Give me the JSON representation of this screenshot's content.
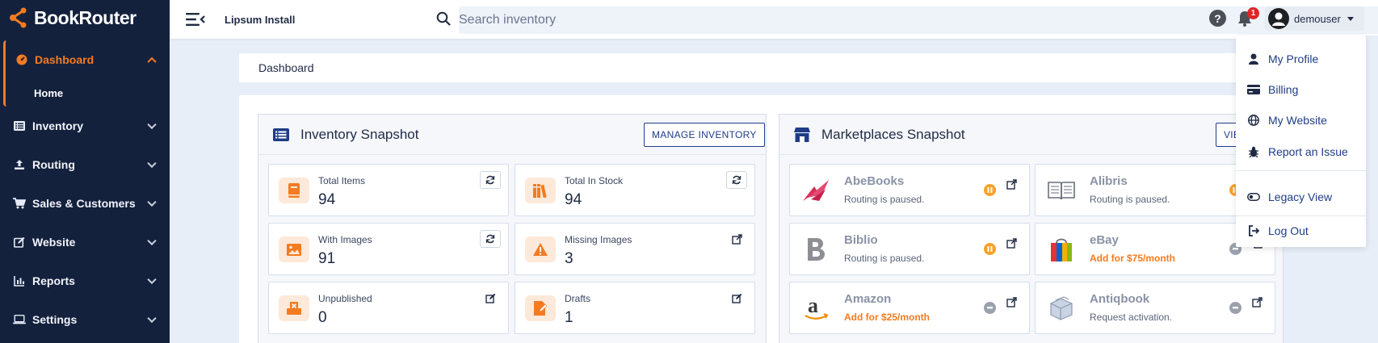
{
  "app": {
    "logo_text": "BookRouter"
  },
  "sidebar": {
    "items": [
      {
        "label": "Dashboard",
        "active": true
      },
      {
        "label": "Inventory"
      },
      {
        "label": "Routing"
      },
      {
        "label": "Sales & Customers"
      },
      {
        "label": "Website"
      },
      {
        "label": "Reports"
      },
      {
        "label": "Settings"
      }
    ],
    "sub_item": "Home"
  },
  "topbar": {
    "install_name": "Lipsum Install",
    "search_placeholder": "Search inventory",
    "help_symbol": "?",
    "notification_count": "1",
    "user_name": "demouser"
  },
  "breadcrumb": "Dashboard",
  "inventory": {
    "title": "Inventory Snapshot",
    "button": "MANAGE INVENTORY",
    "tiles": [
      {
        "label": "Total Items",
        "value": "94",
        "icon": "book-icon",
        "action": "refresh-icon"
      },
      {
        "label": "Total In Stock",
        "value": "94",
        "icon": "books-shelf-icon",
        "action": "refresh-icon"
      },
      {
        "label": "With Images",
        "value": "91",
        "icon": "image-icon",
        "action": "refresh-icon"
      },
      {
        "label": "Missing Images",
        "value": "3",
        "icon": "warning-icon",
        "action": "external-link-icon"
      },
      {
        "label": "Unpublished",
        "value": "0",
        "icon": "unpublished-icon",
        "action": "edit-icon"
      },
      {
        "label": "Drafts",
        "value": "1",
        "icon": "draft-icon",
        "action": "edit-icon"
      }
    ]
  },
  "marketplaces": {
    "title": "Marketplaces Snapshot",
    "button": "VIE",
    "tiles": [
      {
        "name": "AbeBooks",
        "status": "Routing is paused.",
        "state": "paused"
      },
      {
        "name": "Alibris",
        "status": "Routing is paused.",
        "state": "paused"
      },
      {
        "name": "Biblio",
        "status": "Routing is paused.",
        "state": "paused"
      },
      {
        "name": "eBay",
        "status": "Add for $75/month",
        "state": "off"
      },
      {
        "name": "Amazon",
        "status": "Add for $25/month",
        "state": "off"
      },
      {
        "name": "Antiqbook",
        "status": "Request activation.",
        "state": "off"
      }
    ]
  },
  "user_menu": {
    "items": [
      "My Profile",
      "Billing",
      "My Website",
      "Report an Issue",
      "Legacy View",
      "Log Out"
    ]
  },
  "colors": {
    "sidebar": "#14213d",
    "accent": "#f47b20",
    "link": "#1f3c88"
  }
}
